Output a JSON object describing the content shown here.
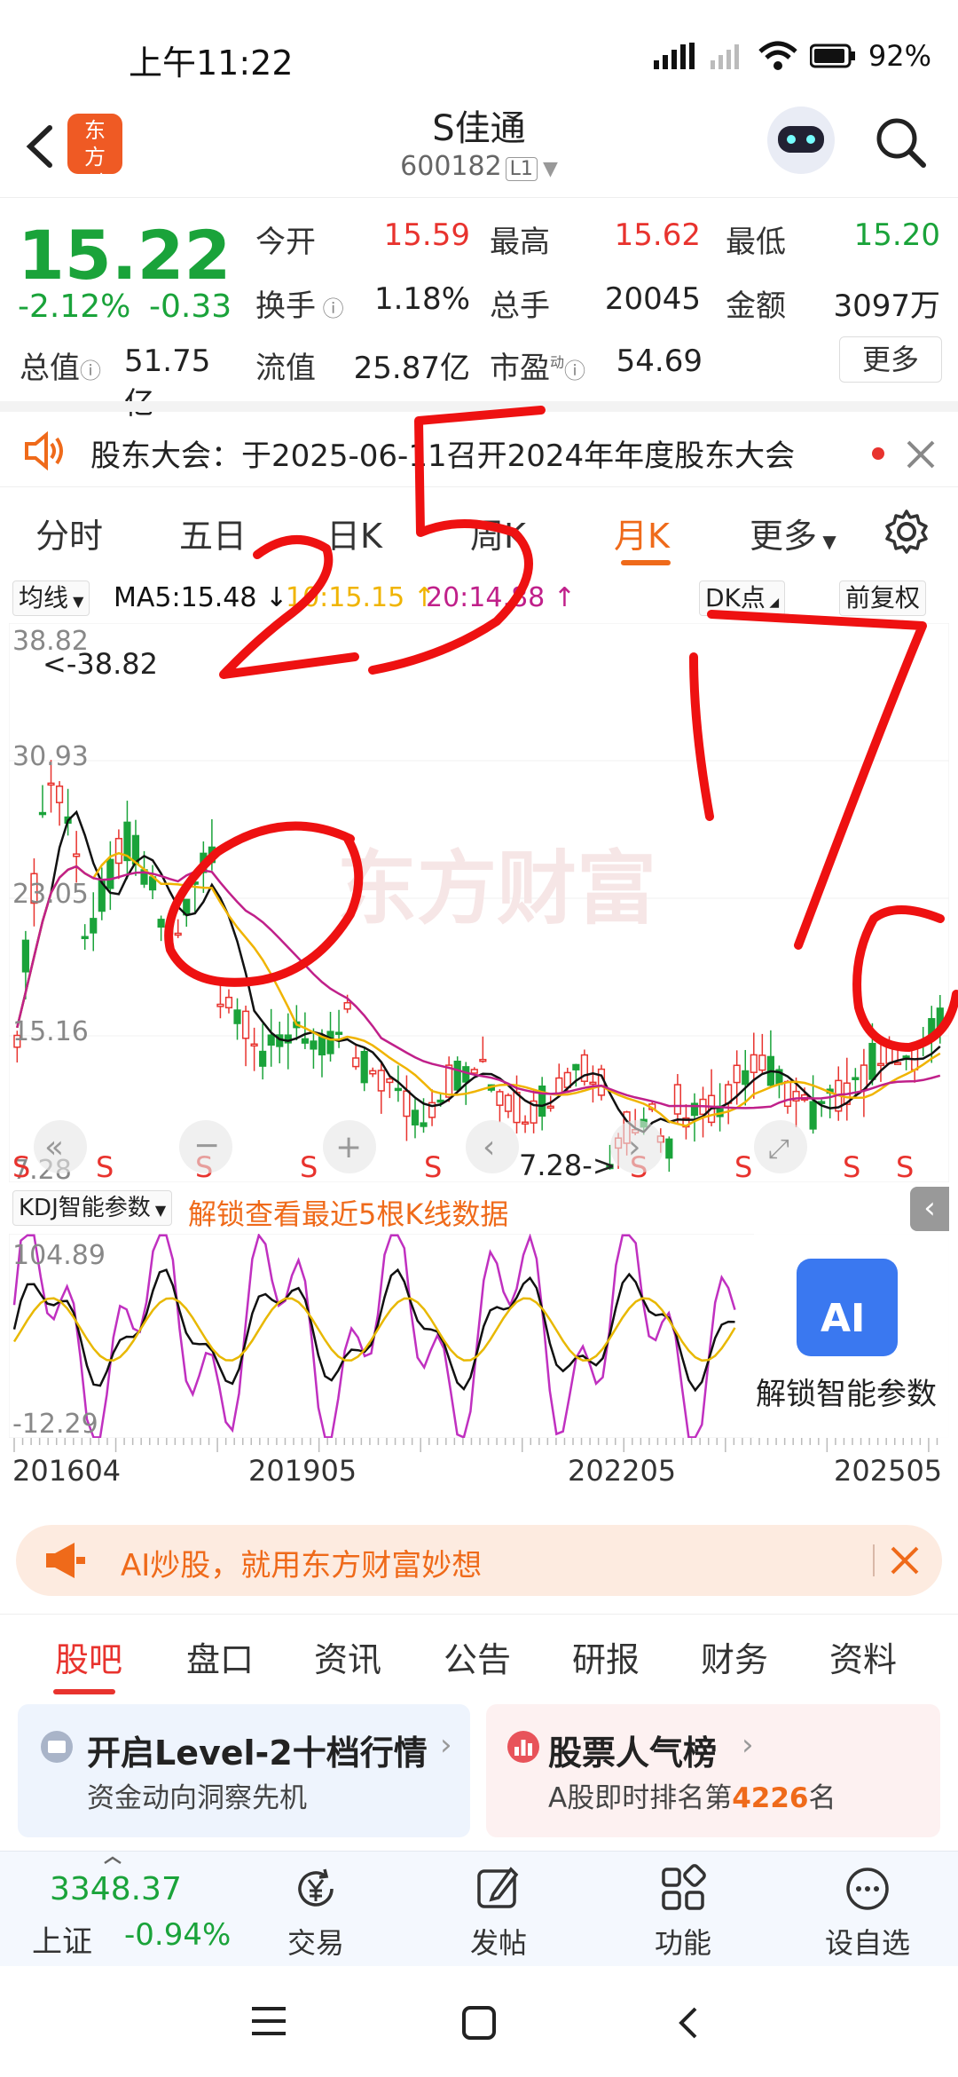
{
  "status": {
    "time": "上午11:22",
    "battery": "92%"
  },
  "header": {
    "logo": "东方财富",
    "name": "S佳通",
    "code": "600182",
    "level": "L1"
  },
  "quote": {
    "price": "15.22",
    "change_pct": "-2.12%",
    "change": "-0.33",
    "open_label": "今开",
    "open": "15.59",
    "high_label": "最高",
    "high": "15.62",
    "low_label": "最低",
    "low": "15.20",
    "turnover_label": "换手",
    "turnover": "1.18%",
    "volume_label": "总手",
    "volume": "20045",
    "amount_label": "金额",
    "amount": "3097万",
    "mktcap_label": "总值",
    "mktcap": "51.75亿",
    "float_label": "流值",
    "float": "25.87亿",
    "pe_label": "市盈",
    "pe_sup": "动",
    "pe": "54.69",
    "more": "更多"
  },
  "notice": {
    "text": "股东大会：于2025-06-11召开2024年年度股东大会"
  },
  "chart_tabs": [
    "分时",
    "五日",
    "日K",
    "周K",
    "月K",
    "更多"
  ],
  "indicators": {
    "ma_select": "均线",
    "ma5": "MA5:15.48 ↓",
    "ma10": "10:15.15 ↑",
    "ma20": "20:14.88 ↑",
    "dk": "DK点",
    "adjust": "前复权"
  },
  "chart": {
    "y_labels": [
      "38.82",
      "30.93",
      "23.05",
      "15.16",
      "7.28"
    ],
    "max_marker": "<-38.82",
    "min_marker": "7.28->",
    "s_marker": "S",
    "watermark": "东方财富"
  },
  "kdj": {
    "select": "KDJ智能参数",
    "unlock": "解锁查看最近5根K线数据",
    "y_top": "104.89",
    "y_bottom": "-12.29",
    "ai_label": "解锁智能参数",
    "ai_icon_text": "AI"
  },
  "x_labels": [
    "201604",
    "201905",
    "202205",
    "202505"
  ],
  "ai_banner": {
    "text": "AI炒股，就用东方财富妙想"
  },
  "info_tabs": [
    "股吧",
    "盘口",
    "资讯",
    "公告",
    "研报",
    "财务",
    "资料"
  ],
  "cards": [
    {
      "title": "开启Level-2十档行情",
      "sub": "资金动向洞察先机"
    },
    {
      "title": "股票人气榜",
      "sub_prefix": "A股即时排名第",
      "rank": "4226",
      "sub_suffix": "名"
    }
  ],
  "bottom": {
    "index_value": "3348.37",
    "index_name": "上证",
    "index_change": "-0.94%",
    "items": [
      "交易",
      "发帖",
      "功能",
      "设自选"
    ]
  },
  "colors": {
    "up": "#e8332e",
    "down": "#1aa33a",
    "accent": "#ef6a1a",
    "ma5": "#111111",
    "ma10": "#f0b400",
    "ma20": "#c0208a"
  }
}
